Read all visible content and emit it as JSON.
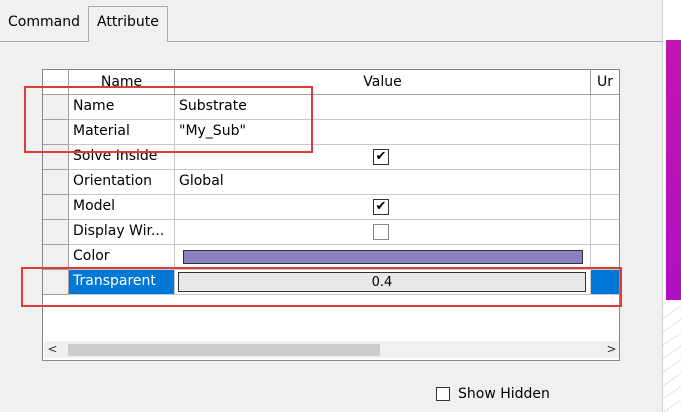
{
  "tabs": [
    {
      "label": "Command",
      "active": false
    },
    {
      "label": "Attribute",
      "active": true
    }
  ],
  "grid": {
    "headers": {
      "name": "Name",
      "value": "Value",
      "unit": "Ur"
    },
    "rows": [
      {
        "name": "Name",
        "value": "Substrate",
        "type": "text"
      },
      {
        "name": "Material",
        "value": "\"My_Sub\"",
        "type": "text"
      },
      {
        "name": "Solve Inside",
        "value": "checked",
        "type": "checkbox"
      },
      {
        "name": "Orientation",
        "value": "Global",
        "type": "text"
      },
      {
        "name": "Model",
        "value": "checked",
        "type": "checkbox"
      },
      {
        "name": "Display Wir...",
        "value": "unchecked",
        "type": "checkbox"
      },
      {
        "name": "Color",
        "value": "#8c7fc2",
        "type": "color"
      },
      {
        "name": "Transparent",
        "value": "0.4",
        "type": "edit",
        "selected": true
      }
    ]
  },
  "scroll": {
    "left_arrow": "<",
    "right_arrow": ">"
  },
  "show_hidden": {
    "label": "Show Hidden",
    "checked": false
  },
  "colors": {
    "selection": "#0078d7",
    "highlight": "#e03a3a",
    "object_color": "#8c7fc2"
  }
}
